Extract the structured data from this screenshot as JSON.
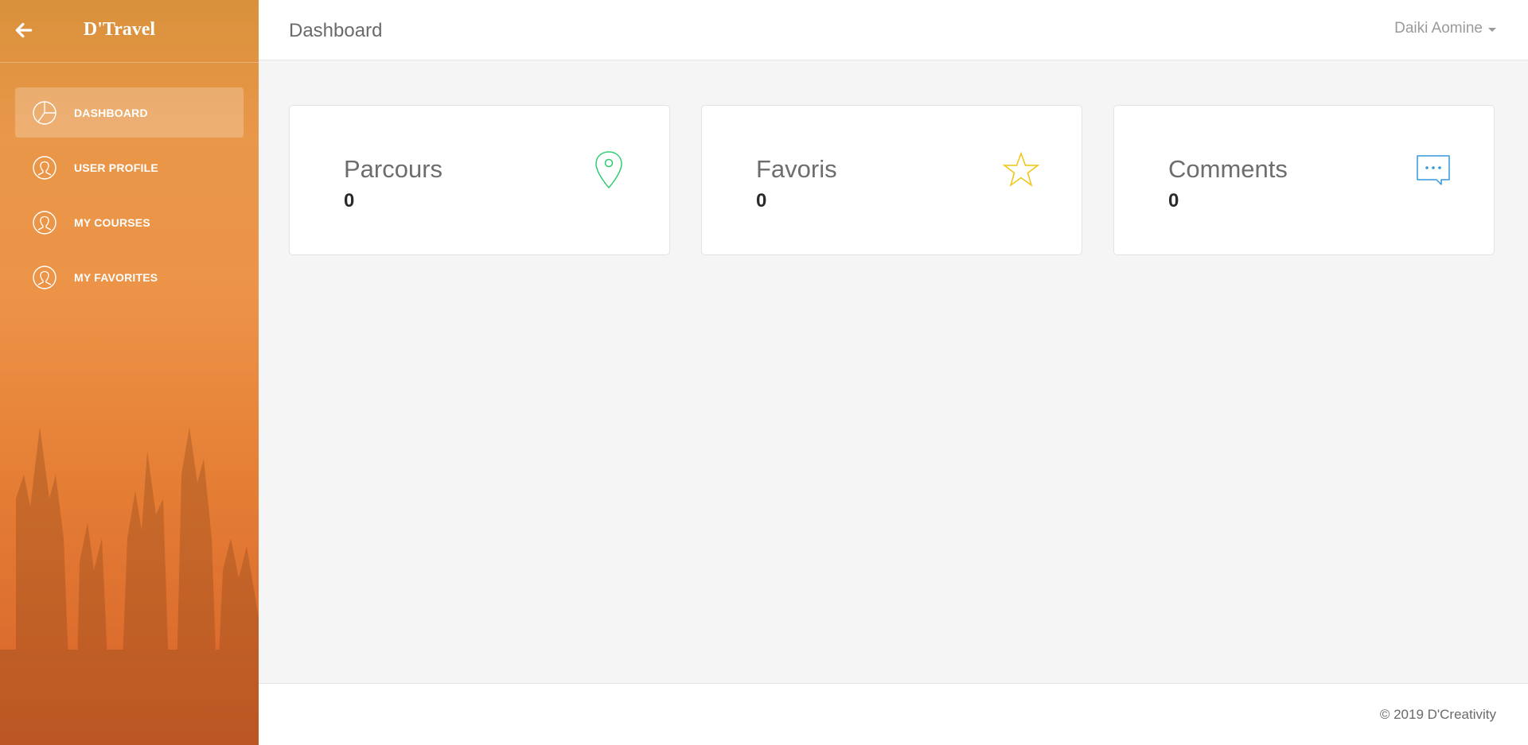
{
  "sidebar": {
    "brand": "D'Travel",
    "back_icon": "arrow-left-icon",
    "items": [
      {
        "label": "DASHBOARD",
        "icon": "pie-chart-icon",
        "active": true
      },
      {
        "label": "USER PROFILE",
        "icon": "user-icon",
        "active": false
      },
      {
        "label": "MY COURSES",
        "icon": "user-icon",
        "active": false
      },
      {
        "label": "MY FAVORITES",
        "icon": "user-icon",
        "active": false
      }
    ],
    "gradient_top": "#d9913b",
    "gradient_bottom": "#d6622a"
  },
  "header": {
    "title": "Dashboard",
    "user_name": "Daiki Aomine"
  },
  "cards": [
    {
      "title": "Parcours",
      "value": "0",
      "icon": "map-pin-icon",
      "color": "#2ecc71"
    },
    {
      "title": "Favoris",
      "value": "0",
      "icon": "star-icon",
      "color": "#f1c40f"
    },
    {
      "title": "Comments",
      "value": "0",
      "icon": "chat-bubble-icon",
      "color": "#3498db"
    }
  ],
  "footer": {
    "copyright": "© 2019 D'Creativity"
  }
}
